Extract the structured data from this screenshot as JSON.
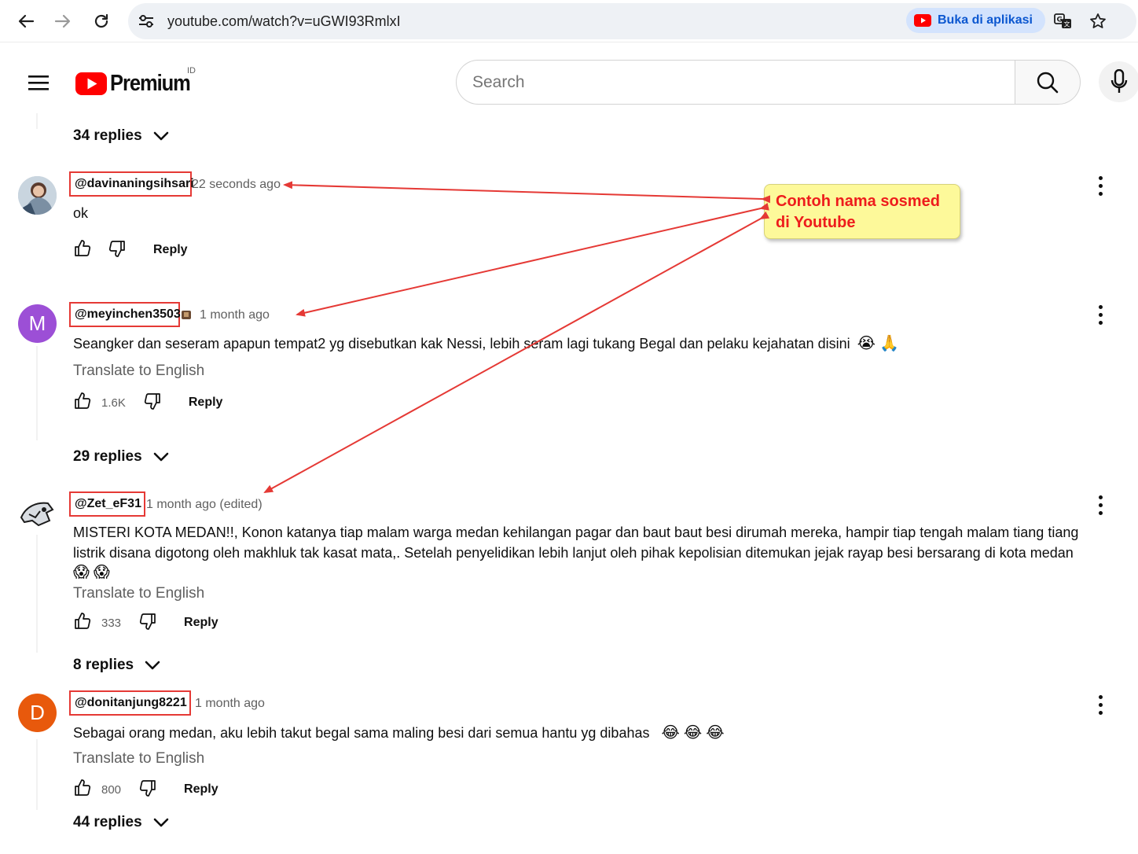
{
  "browser": {
    "url": "youtube.com/watch?v=uGWI93RmlxI",
    "open_in_app_label": "Buka di aplikasi"
  },
  "header": {
    "logo_text": "Premium",
    "country_code": "ID",
    "search_placeholder": "Search"
  },
  "colors": {
    "annotation_red": "#e53935",
    "callout_fill": "#fdf99a",
    "callout_text": "#ee1c1c",
    "yt_red": "#ff0000"
  },
  "callout": {
    "line1": "Contoh nama sosmed",
    "line2": "di Youtube"
  },
  "top_replies": "34 replies",
  "comments": [
    {
      "author": "@davinaningsihsari",
      "time": "22 seconds ago",
      "text": "ok",
      "reply_label": "Reply"
    },
    {
      "author": "@meyinchen3503",
      "time": "1 month ago",
      "avatar_letter": "M",
      "text": "Seangker dan seseram apapun tempat2 yg disebutkan kak Nessi, lebih seram lagi tukang Begal dan pelaku kejahatan disini",
      "translate": "Translate to English",
      "likes": "1.6K",
      "reply_label": "Reply",
      "replies": "29 replies"
    },
    {
      "author": "@Zet_eF31",
      "time": "1 month ago (edited)",
      "text_line1": "MISTERI KOTA MEDAN!!, Konon katanya tiap malam warga medan kehilangan pagar dan baut baut besi dirumah mereka, hampir tiap tengah malam tiang tiang",
      "text_line2": "listrik disana digotong oleh makhluk tak kasat mata,. Setelah penyelidikan lebih lanjut oleh pihak kepolisian ditemukan jejak rayap besi bersarang di kota medan",
      "translate": "Translate to English",
      "likes": "333",
      "reply_label": "Reply",
      "replies": "8 replies"
    },
    {
      "author": "@donitanjung8221",
      "time": "1 month ago",
      "avatar_letter": "D",
      "text": "Sebagai orang medan, aku lebih takut begal sama maling besi dari semua hantu yg dibahas",
      "translate": "Translate to English",
      "likes": "800",
      "reply_label": "Reply",
      "replies": "44 replies"
    }
  ]
}
